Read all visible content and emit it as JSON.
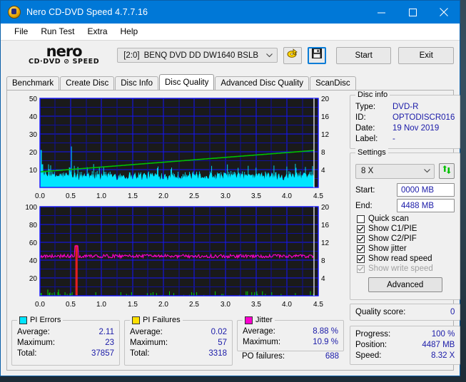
{
  "window": {
    "title": "Nero CD-DVD Speed 4.7.7.16",
    "app_icon": "nero-disc-icon",
    "minimize": "minimize-icon",
    "maximize": "maximize-icon",
    "close": "close-icon"
  },
  "menu": [
    "File",
    "Run Test",
    "Extra",
    "Help"
  ],
  "toolbar": {
    "logo_line1": "nero",
    "logo_line2": "CD·DVD ⊘ SPEED",
    "drive_index": "[2:0]",
    "drive_name": "BENQ DVD DD DW1640 BSLB",
    "eject_icon": "eject-disc-icon",
    "save_icon": "save-floppy-icon",
    "start_label": "Start",
    "exit_label": "Exit"
  },
  "tabs": [
    {
      "label": "Benchmark",
      "active": false
    },
    {
      "label": "Create Disc",
      "active": false
    },
    {
      "label": "Disc Info",
      "active": false
    },
    {
      "label": "Disc Quality",
      "active": true
    },
    {
      "label": "Advanced Disc Quality",
      "active": false
    },
    {
      "label": "ScanDisc",
      "active": false
    }
  ],
  "disc_info": {
    "title": "Disc info",
    "type_label": "Type:",
    "type_value": "DVD-R",
    "id_label": "ID:",
    "id_value": "OPTODISCR016",
    "date_label": "Date:",
    "date_value": "19 Nov 2019",
    "label_label": "Label:",
    "label_value": "-"
  },
  "settings": {
    "title": "Settings",
    "speed": "8 X",
    "refresh_icon": "refresh-icon",
    "start_label": "Start:",
    "start_value": "0000 MB",
    "end_label": "End:",
    "end_value": "4488 MB",
    "checkboxes": [
      {
        "label": "Quick scan",
        "checked": false,
        "disabled": false
      },
      {
        "label": "Show C1/PIE",
        "checked": true,
        "disabled": false
      },
      {
        "label": "Show C2/PIF",
        "checked": true,
        "disabled": false
      },
      {
        "label": "Show jitter",
        "checked": true,
        "disabled": false
      },
      {
        "label": "Show read speed",
        "checked": true,
        "disabled": false
      },
      {
        "label": "Show write speed",
        "checked": true,
        "disabled": true
      }
    ],
    "advanced_label": "Advanced"
  },
  "quality": {
    "label": "Quality score:",
    "value": "0"
  },
  "progress": {
    "progress_label": "Progress:",
    "progress_value": "100 %",
    "position_label": "Position:",
    "position_value": "4487 MB",
    "speed_label": "Speed:",
    "speed_value": "8.32 X"
  },
  "stats": {
    "pi_errors": {
      "title": "PI Errors",
      "color": "#00e5ff",
      "rows": [
        {
          "k": "Average:",
          "v": "2.11"
        },
        {
          "k": "Maximum:",
          "v": "23"
        },
        {
          "k": "Total:",
          "v": "37857"
        }
      ]
    },
    "pi_failures": {
      "title": "PI Failures",
      "color": "#ffe000",
      "rows": [
        {
          "k": "Average:",
          "v": "0.02"
        },
        {
          "k": "Maximum:",
          "v": "57"
        },
        {
          "k": "Total:",
          "v": "3318"
        }
      ]
    },
    "jitter": {
      "title": "Jitter",
      "color": "#ff00d0",
      "rows": [
        {
          "k": "Average:",
          "v": "8.88 %"
        },
        {
          "k": "Maximum:",
          "v": "10.9 %"
        }
      ],
      "po_label": "PO failures:",
      "po_value": "688"
    }
  },
  "chart_data": [
    {
      "type": "area",
      "name": "pi-errors-chart",
      "title": "",
      "xlabel": "",
      "ylabel": "",
      "x_ticks": [
        "0.0",
        "0.5",
        "1.0",
        "1.5",
        "2.0",
        "2.5",
        "3.0",
        "3.5",
        "4.0",
        "4.5"
      ],
      "xlim": [
        0,
        4.5
      ],
      "y_left_ticks": [
        "10",
        "20",
        "30",
        "40",
        "50"
      ],
      "ylim_left": [
        0,
        50
      ],
      "y_right_ticks": [
        "4",
        "8",
        "12",
        "16",
        "20"
      ],
      "ylim_right": [
        0,
        20
      ],
      "grid": true,
      "bg": "#1a1a1a",
      "grid_color": "#1414ff",
      "series": [
        {
          "name": "PI Errors",
          "color": "#00e5ff",
          "kind": "area",
          "note": "dense noisy band averaging ~6, maxima to 23 near 0.0 and 0.6",
          "values": [
            21,
            13,
            9,
            17,
            12,
            8,
            11,
            9,
            7,
            10,
            8,
            9,
            7,
            8,
            6,
            9,
            7,
            8,
            6,
            7,
            9,
            6,
            8,
            7,
            6,
            8,
            7,
            6,
            9,
            7,
            6,
            8,
            7,
            6,
            7,
            8,
            6,
            7,
            9,
            7,
            6,
            8,
            7,
            9,
            23,
            11,
            8,
            7,
            9,
            6,
            8,
            13,
            7,
            6,
            9,
            7,
            8,
            6,
            7,
            9,
            6,
            8,
            7,
            6,
            8,
            7,
            9,
            6,
            7,
            8,
            6,
            7,
            9,
            6,
            8,
            7,
            6,
            9,
            7,
            6,
            8,
            7,
            9,
            6,
            7,
            8,
            6,
            9,
            7,
            6,
            8,
            7,
            6,
            9,
            7,
            8,
            6,
            7,
            9,
            6,
            7,
            8,
            6,
            9,
            7,
            6,
            8,
            7,
            9,
            6,
            7,
            8,
            6,
            9,
            7,
            6,
            8,
            7,
            6,
            9,
            7,
            8,
            6,
            7,
            9,
            6,
            8,
            7,
            6,
            8,
            7,
            9,
            6,
            7,
            8,
            6,
            9,
            7,
            6,
            8,
            7,
            9,
            6,
            7,
            8,
            6,
            9,
            7,
            6,
            8,
            7,
            6,
            9,
            7,
            8,
            6,
            7,
            9,
            6,
            8,
            7,
            6,
            9,
            7,
            8,
            6,
            7,
            9,
            6,
            8,
            7,
            6,
            8,
            7,
            9,
            6,
            7,
            8,
            6,
            9,
            7,
            6,
            8,
            7,
            9,
            6,
            7,
            8,
            6,
            9
          ]
        },
        {
          "name": "Read speed",
          "color": "#00c000",
          "kind": "line",
          "axis": "right",
          "note": "rises linearly from ~3.5X at 0.0 to ~8.3X at 4.4",
          "start": 3.5,
          "end": 8.3
        }
      ]
    },
    {
      "type": "line",
      "name": "pif-jitter-chart",
      "title": "",
      "xlabel": "",
      "ylabel": "",
      "x_ticks": [
        "0.0",
        "0.5",
        "1.0",
        "1.5",
        "2.0",
        "2.5",
        "3.0",
        "3.5",
        "4.0",
        "4.5"
      ],
      "xlim": [
        0,
        4.5
      ],
      "y_left_ticks": [
        "20",
        "40",
        "60",
        "80",
        "100"
      ],
      "ylim_left": [
        0,
        100
      ],
      "y_right_ticks": [
        "4",
        "8",
        "12",
        "16",
        "20"
      ],
      "ylim_right": [
        0,
        20
      ],
      "grid": true,
      "bg": "#1a1a1a",
      "grid_color": "#1414ff",
      "series": [
        {
          "name": "Jitter",
          "color": "#ff00d0",
          "kind": "line",
          "axis": "right",
          "note": "flat ~8.9% with small noise; spike to ~11% at 0.6",
          "baseline": 8.9,
          "spike_x": 0.6,
          "spike_y": 11.2
        },
        {
          "name": "PI Failures",
          "color": "#00d000",
          "kind": "bars",
          "axis": "left",
          "note": "sparse short green spikes near 0, one tall red spike to 57 at 0.6"
        },
        {
          "name": "PIF peak",
          "color": "#ff2020",
          "kind": "bars",
          "axis": "left",
          "note": "single red column reaching 57 at x=0.6"
        }
      ]
    }
  ]
}
